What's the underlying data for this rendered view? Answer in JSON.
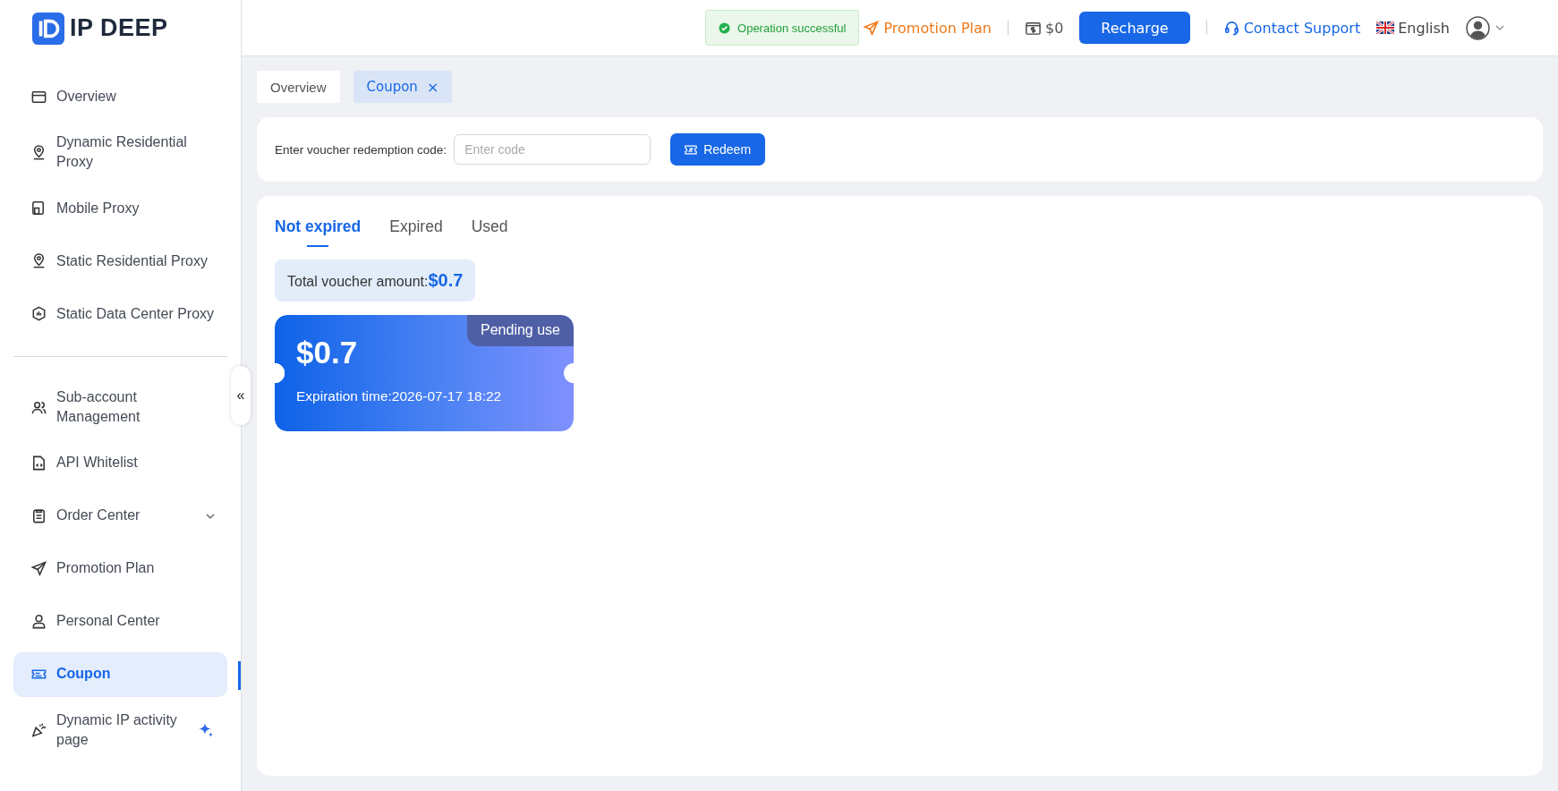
{
  "brand": {
    "name": "IP DEEP"
  },
  "sidebar": {
    "collapse_glyph": "«",
    "sections": [
      {
        "items": [
          {
            "label": "Overview",
            "kind": "link",
            "selected": false
          },
          {
            "label": "Dynamic Residential Proxy",
            "kind": "link",
            "selected": false
          },
          {
            "label": "Mobile Proxy",
            "kind": "link",
            "selected": false
          },
          {
            "label": "Static Residential Proxy",
            "kind": "link",
            "selected": false
          },
          {
            "label": "Static Data Center Proxy",
            "kind": "link",
            "selected": false
          }
        ]
      },
      {
        "items": [
          {
            "label": "Sub-account Management",
            "kind": "link",
            "selected": false
          },
          {
            "label": "API Whitelist",
            "kind": "link",
            "selected": false
          },
          {
            "label": "Order Center",
            "kind": "submenu",
            "selected": false
          },
          {
            "label": "Promotion Plan",
            "kind": "link",
            "selected": false
          },
          {
            "label": "Personal Center",
            "kind": "link",
            "selected": false
          },
          {
            "label": "Coupon",
            "kind": "link",
            "selected": true
          },
          {
            "label": "Dynamic IP activity page",
            "kind": "featured",
            "selected": false
          }
        ]
      }
    ]
  },
  "header": {
    "toast": "Operation successful",
    "promotion": "Promotion Plan",
    "balance": "$0",
    "recharge": "Recharge",
    "support": "Contact Support",
    "language": "English"
  },
  "page_tabs": [
    {
      "label": "Overview",
      "selected": false,
      "closable": false
    },
    {
      "label": "Coupon",
      "selected": true,
      "closable": true,
      "close_glyph": "×"
    }
  ],
  "redeem": {
    "label": "Enter voucher redemption code:",
    "placeholder": "Enter code",
    "button": "Redeem"
  },
  "coupon_tabs": [
    {
      "label": "Not expired",
      "selected": true
    },
    {
      "label": "Expired",
      "selected": false
    },
    {
      "label": "Used",
      "selected": false
    }
  ],
  "total": {
    "label": "Total voucher amount:",
    "value": "$0.7"
  },
  "vouchers": [
    {
      "amount": "$0.7",
      "status": "Pending use",
      "expiration": "Expiration time:2026-07-17 18:22"
    }
  ]
}
